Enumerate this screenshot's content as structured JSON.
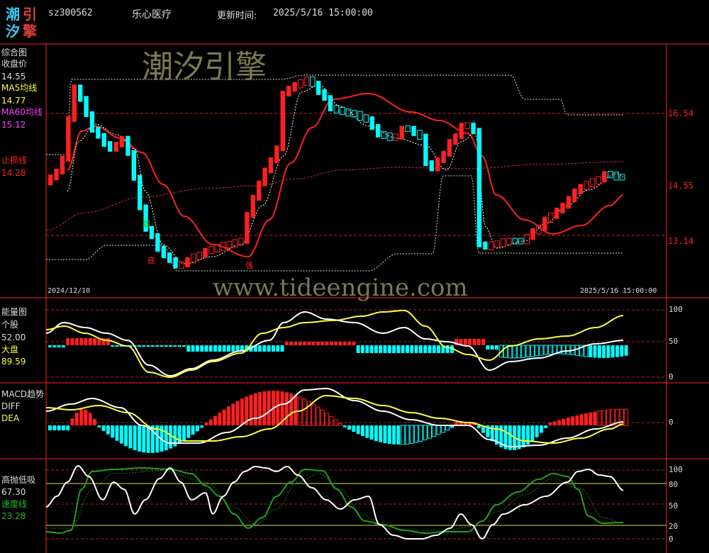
{
  "logo": {
    "c1": "潮",
    "c2": "引",
    "c3": "汐",
    "c4": "擎"
  },
  "header": {
    "code": "sz300562",
    "name": "乐心医疗",
    "update_label": "更新时间:",
    "update_time": "2025/5/16 15:00:00"
  },
  "watermark_cn": "潮汐引擎",
  "watermark_url": "www.tideengine.com",
  "panel_main": {
    "title": "综合图",
    "close_label": "收盘价",
    "close_value": "14.55",
    "ma5_label": "MA5均线",
    "ma5_value": "14.77",
    "ma60_label": "MA60均线",
    "ma60_value": "15.12",
    "stop_label": "止损线",
    "stop_value": "14.28",
    "axis_ticks": [
      "16.54",
      "14.55",
      "13.14"
    ],
    "date_start": "2024/12/10",
    "date_end": "2025/5/16 15:00:00",
    "mark_bottom": "底",
    "mark_strong": "强",
    "mark_weak": "弱"
  },
  "panel_energy": {
    "title": "能量图",
    "stock_label": "个股",
    "stock_value": "52.00",
    "market_label": "大盘",
    "market_value": "89.59",
    "axis_ticks": [
      "100",
      "50",
      "0"
    ]
  },
  "panel_macd": {
    "title": "MACD趋势",
    "diff_label": "DIFF",
    "dea_label": "DEA",
    "axis_ticks": [
      "0"
    ]
  },
  "panel_kdj": {
    "title": "高抛低吸",
    "value1": "67.30",
    "speed_label": "速度线",
    "speed_value": "23.28",
    "axis_ticks": [
      "100",
      "80",
      "50",
      "20",
      "0"
    ]
  },
  "colors": {
    "red": "#ff2020",
    "cyan": "#00ffff",
    "yellow": "#ffff40",
    "magenta": "#ff40ff",
    "white": "#ffffff",
    "green": "#20c020",
    "logo_cyan": "#3fc8f0",
    "logo_red": "#e04040"
  }
}
